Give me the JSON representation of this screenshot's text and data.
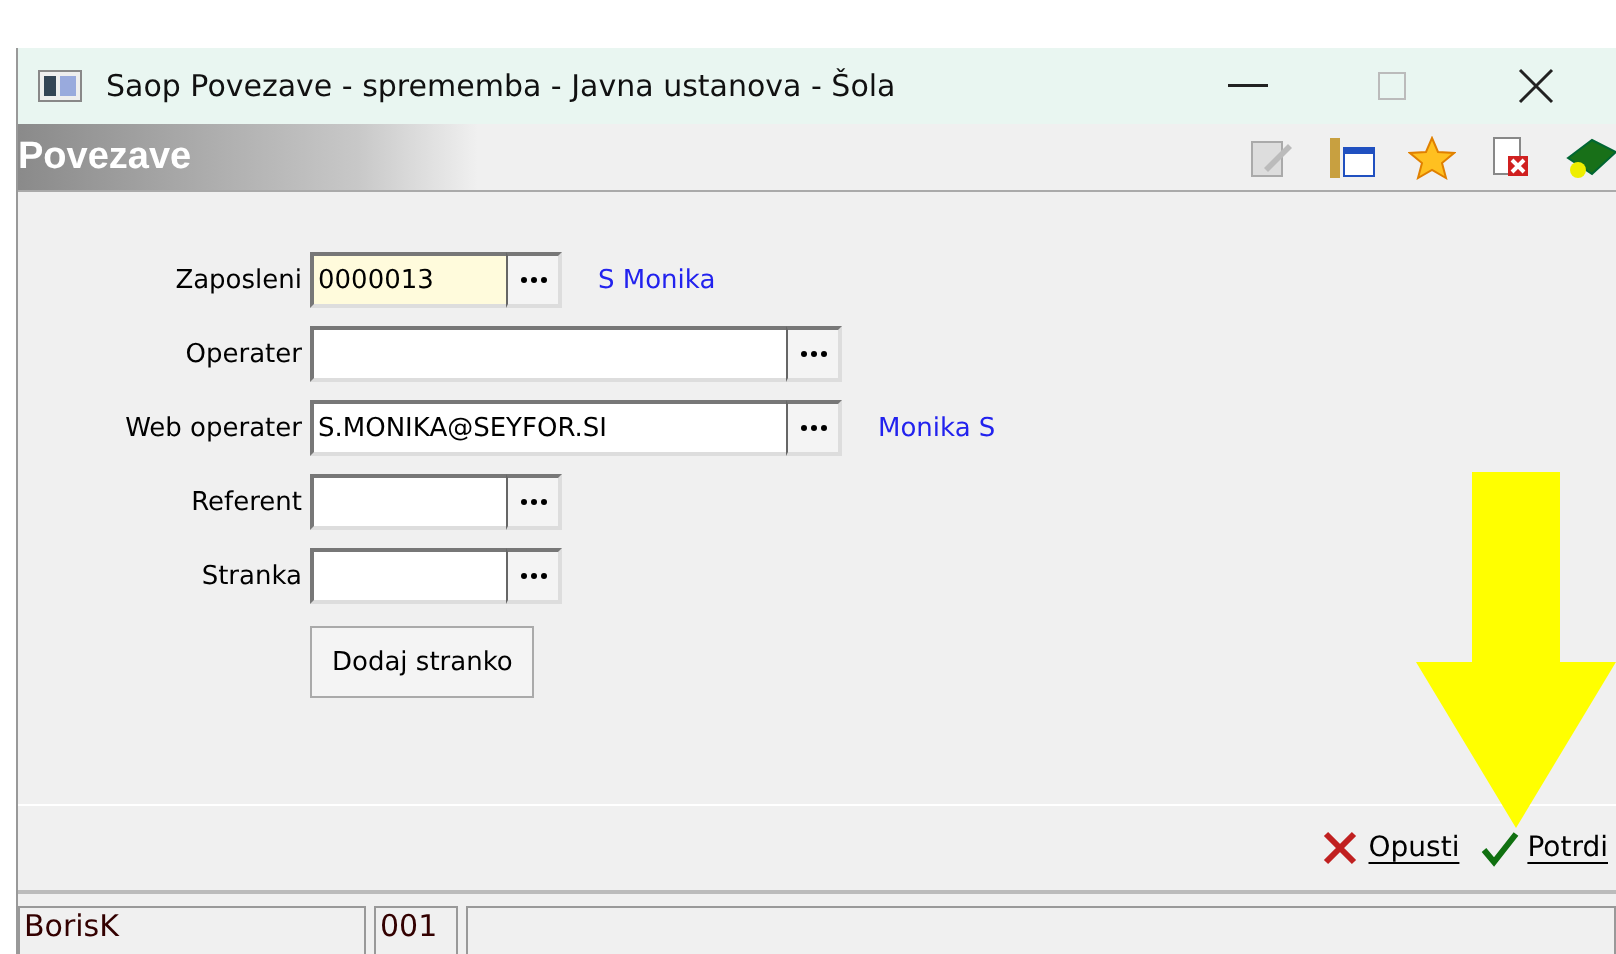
{
  "window": {
    "title": "Saop Povezave - sprememba - Javna ustanova - Šola"
  },
  "header": {
    "title": "Povezave"
  },
  "fields": [
    {
      "label": "Zaposleni",
      "value": "0000013",
      "kind": "short",
      "highlighted": true,
      "note": "S Monika"
    },
    {
      "label": "Operater",
      "kind": "long",
      "highlighted": false
    },
    {
      "label": "Web operater",
      "value": "S.MONIKA@SEYFOR.SI",
      "kind": "long",
      "highlighted": false,
      "note": "Monika S"
    },
    {
      "label": "Referent",
      "kind": "short",
      "highlighted": false
    },
    {
      "label": "Stranka",
      "kind": "short",
      "highlighted": false
    }
  ],
  "add_button": "Dodaj stranko",
  "actions": [
    {
      "kind": "cancel",
      "label": "Opusti"
    },
    {
      "kind": "confirm",
      "label": "Potrdi"
    }
  ],
  "status_bar": {
    "user": "BorisK",
    "code": "001"
  }
}
